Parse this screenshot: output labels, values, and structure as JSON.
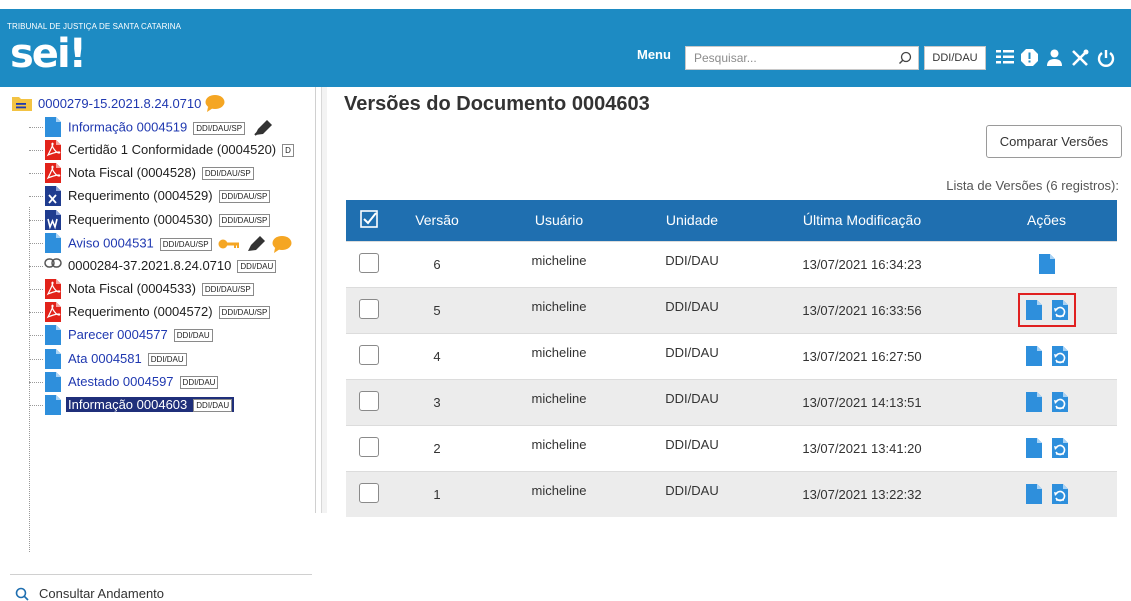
{
  "header": {
    "org_name": "TRIBUNAL DE JUSTIÇA DE SANTA CATARINA",
    "logo_text": "sei",
    "logo_mark": "!",
    "menu_label": "Menu",
    "search_placeholder": "Pesquisar...",
    "unit_label": "DDI/DAU",
    "icons": [
      "search-icon",
      "control-panel-icon",
      "alert-icon",
      "user-icon",
      "tools-icon",
      "power-icon"
    ]
  },
  "tree": {
    "root_label": "0000279-15.2021.8.24.0710",
    "items": [
      {
        "label": "Informação 0004519",
        "tag": "DDI/DAU/SP",
        "icon": "doc-blue-icon"
      },
      {
        "label": "Certidão 1 Conformidade (0004520)",
        "tag": "D",
        "icon": "pdf-icon"
      },
      {
        "label": "Nota Fiscal (0004528)",
        "tag": "DDI/DAU/SP",
        "icon": "pdf-icon"
      },
      {
        "label": "Requerimento (0004529)",
        "tag": "DDI/DAU/SP",
        "icon": "excel-icon"
      },
      {
        "label": "Requerimento (0004530)",
        "tag": "DDI/DAU/SP",
        "icon": "word-icon"
      },
      {
        "label": "Aviso 0004531",
        "tag": "DDI/DAU/SP",
        "icon": "doc-blue-icon"
      },
      {
        "label": "0000284-37.2021.8.24.0710",
        "tag": "DDI/DAU",
        "icon": "link-icon"
      },
      {
        "label": "Nota Fiscal (0004533)",
        "tag": "DDI/DAU/SP",
        "icon": "pdf-icon"
      },
      {
        "label": "Requerimento (0004572)",
        "tag": "DDI/DAU/SP",
        "icon": "pdf-icon"
      },
      {
        "label": "Parecer 0004577",
        "tag": "DDI/DAU",
        "icon": "doc-blue-icon"
      },
      {
        "label": "Ata 0004581",
        "tag": "DDI/DAU",
        "icon": "doc-blue-icon"
      },
      {
        "label": "Atestado 0004597",
        "tag": "DDI/DAU",
        "icon": "doc-blue-icon"
      },
      {
        "label": "Informação 0004603",
        "tag": "DDI/DAU",
        "icon": "doc-blue-icon"
      }
    ],
    "consult_label": "Consultar Andamento"
  },
  "main": {
    "title": "Versões do Documento 0004603",
    "compare_button": "Comparar Versões",
    "list_caption": "Lista de Versões (6 registros):",
    "columns": {
      "version": "Versão",
      "user": "Usuário",
      "unit": "Unidade",
      "modified": "Última Modificação",
      "actions": "Ações"
    },
    "rows": [
      {
        "version": "6",
        "user": "micheline",
        "unit": "DDI/DAU",
        "modified": "13/07/2021 16:34:23"
      },
      {
        "version": "5",
        "user": "micheline",
        "unit": "DDI/DAU",
        "modified": "13/07/2021 16:33:56"
      },
      {
        "version": "4",
        "user": "micheline",
        "unit": "DDI/DAU",
        "modified": "13/07/2021 16:27:50"
      },
      {
        "version": "3",
        "user": "micheline",
        "unit": "DDI/DAU",
        "modified": "13/07/2021 14:13:51"
      },
      {
        "version": "2",
        "user": "micheline",
        "unit": "DDI/DAU",
        "modified": "13/07/2021 13:41:20"
      },
      {
        "version": "1",
        "user": "micheline",
        "unit": "DDI/DAU",
        "modified": "13/07/2021 13:22:32"
      }
    ]
  },
  "colors": {
    "header_bg": "#1d8bc3",
    "table_header_bg": "#1f6fb0",
    "link": "#1f38b0",
    "highlight": "#e02020"
  }
}
